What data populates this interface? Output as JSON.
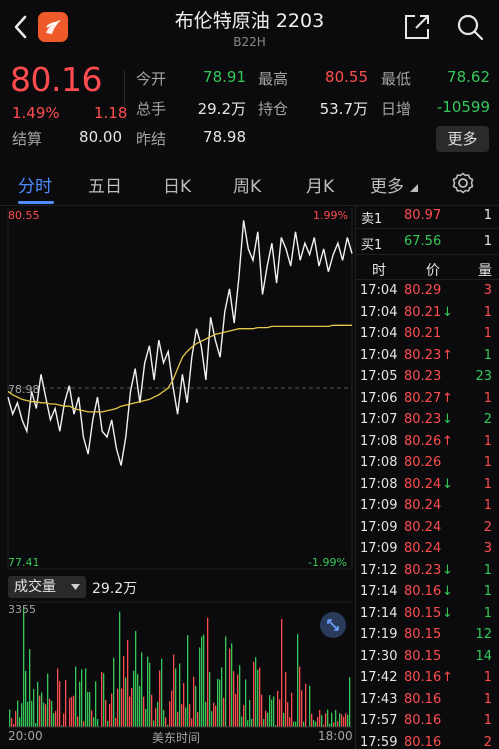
{
  "header": {
    "title": "布伦特原油 2203",
    "subtitle": "B22H"
  },
  "quote": {
    "price": "80.16",
    "change_pct": "1.49%",
    "change": "1.18",
    "settle_label": "结算",
    "settle_value": "80.00",
    "fields": [
      {
        "label": "今开",
        "value": "78.91",
        "color": "#35c759"
      },
      {
        "label": "最高",
        "value": "80.55",
        "color": "#ff4d4f"
      },
      {
        "label": "最低",
        "value": "78.62",
        "color": "#35c759"
      },
      {
        "label": "总手",
        "value": "29.2万",
        "color": "#e6e6e6"
      },
      {
        "label": "持仓",
        "value": "53.7万",
        "color": "#e6e6e6"
      },
      {
        "label": "日增",
        "value": "-10599",
        "color": "#35c759"
      },
      {
        "label": "昨结",
        "value": "78.98",
        "color": "#e6e6e6"
      }
    ],
    "more_label": "更多"
  },
  "tabs": [
    {
      "label": "分时",
      "active": true
    },
    {
      "label": "五日"
    },
    {
      "label": "日K"
    },
    {
      "label": "周K"
    },
    {
      "label": "月K"
    },
    {
      "label": "更多"
    }
  ],
  "chart": {
    "top_left": "80.55",
    "top_right": "1.99%",
    "mid_left": "78.98",
    "bottom_left": "77.41",
    "bottom_right": "-1.99%",
    "x_start": "20:00",
    "x_mid": "美东时间",
    "x_end": "18:00"
  },
  "volume": {
    "label": "成交量",
    "value": "29.2万",
    "max_label": "3355"
  },
  "orderbook": [
    {
      "side": "卖1",
      "price": "80.97",
      "qty": "1",
      "color": "#ff4d4f"
    },
    {
      "side": "买1",
      "price": "67.56",
      "qty": "1",
      "color": "#35c759"
    }
  ],
  "trades_header": {
    "time": "时",
    "price": "价",
    "qty": "量"
  },
  "trades": [
    {
      "time": "17:04",
      "price": "80.29",
      "arrow": "",
      "qty": "3",
      "qcolor": "#ff4d4f"
    },
    {
      "time": "17:04",
      "price": "80.21",
      "arrow": "↓",
      "qty": "1",
      "qcolor": "#ff4d4f"
    },
    {
      "time": "17:04",
      "price": "80.21",
      "arrow": "",
      "qty": "1",
      "qcolor": "#ff4d4f"
    },
    {
      "time": "17:04",
      "price": "80.23",
      "arrow": "↑",
      "qty": "1",
      "qcolor": "#35c759"
    },
    {
      "time": "17:05",
      "price": "80.23",
      "arrow": "",
      "qty": "23",
      "qcolor": "#35c759"
    },
    {
      "time": "17:06",
      "price": "80.27",
      "arrow": "↑",
      "qty": "1",
      "qcolor": "#ff4d4f"
    },
    {
      "time": "17:07",
      "price": "80.23",
      "arrow": "↓",
      "qty": "2",
      "qcolor": "#35c759"
    },
    {
      "time": "17:08",
      "price": "80.26",
      "arrow": "↑",
      "qty": "1",
      "qcolor": "#ff4d4f"
    },
    {
      "time": "17:08",
      "price": "80.26",
      "arrow": "",
      "qty": "1",
      "qcolor": "#ff4d4f"
    },
    {
      "time": "17:08",
      "price": "80.24",
      "arrow": "↓",
      "qty": "1",
      "qcolor": "#ff4d4f"
    },
    {
      "time": "17:09",
      "price": "80.24",
      "arrow": "",
      "qty": "1",
      "qcolor": "#ff4d4f"
    },
    {
      "time": "17:09",
      "price": "80.24",
      "arrow": "",
      "qty": "2",
      "qcolor": "#ff4d4f"
    },
    {
      "time": "17:09",
      "price": "80.24",
      "arrow": "",
      "qty": "3",
      "qcolor": "#ff4d4f"
    },
    {
      "time": "17:12",
      "price": "80.23",
      "arrow": "↓",
      "qty": "1",
      "qcolor": "#35c759"
    },
    {
      "time": "17:14",
      "price": "80.16",
      "arrow": "↓",
      "qty": "1",
      "qcolor": "#35c759"
    },
    {
      "time": "17:14",
      "price": "80.15",
      "arrow": "↓",
      "qty": "1",
      "qcolor": "#35c759"
    },
    {
      "time": "17:19",
      "price": "80.15",
      "arrow": "",
      "qty": "12",
      "qcolor": "#35c759"
    },
    {
      "time": "17:30",
      "price": "80.15",
      "arrow": "",
      "qty": "14",
      "qcolor": "#35c759"
    },
    {
      "time": "17:42",
      "price": "80.16",
      "arrow": "↑",
      "qty": "1",
      "qcolor": "#ff4d4f"
    },
    {
      "time": "17:43",
      "price": "80.16",
      "arrow": "",
      "qty": "1",
      "qcolor": "#ff4d4f"
    },
    {
      "time": "17:57",
      "price": "80.16",
      "arrow": "",
      "qty": "1",
      "qcolor": "#ff4d4f"
    },
    {
      "time": "17:59",
      "price": "80.16",
      "arrow": "",
      "qty": "2",
      "qcolor": "#ff4d4f"
    }
  ],
  "chart_data": {
    "type": "line",
    "ylim": [
      77.41,
      80.55
    ],
    "baseline": 78.98,
    "series": [
      {
        "values": [
          78.9,
          78.75,
          78.85,
          78.7,
          78.6,
          78.95,
          78.8,
          79.1,
          78.9,
          78.7,
          78.8,
          78.6,
          78.85,
          79.0,
          78.75,
          78.9,
          78.55,
          78.4,
          78.7,
          78.9,
          78.6,
          78.55,
          78.7,
          78.45,
          78.3,
          78.55,
          78.95,
          79.15,
          78.85,
          79.2,
          79.35,
          79.05,
          79.4,
          79.2,
          79.3,
          79.0,
          78.75,
          79.1,
          78.85,
          79.25,
          79.5,
          79.35,
          79.05,
          79.6,
          79.4,
          79.25,
          79.65,
          79.85,
          79.55,
          79.95,
          80.45,
          80.2,
          80.1,
          80.35,
          79.8,
          80.05,
          80.25,
          79.9,
          80.3,
          80.2,
          80.05,
          80.35,
          80.1,
          80.25,
          80.15,
          80.3,
          80.05,
          80.2,
          80.0,
          80.15,
          80.25,
          80.1,
          80.3,
          80.16
        ]
      },
      {
        "values": [
          78.95,
          78.92,
          78.9,
          78.88,
          78.87,
          78.86,
          78.86,
          78.85,
          78.85,
          78.84,
          78.84,
          78.83,
          78.82,
          78.82,
          78.8,
          78.79,
          78.78,
          78.77,
          78.77,
          78.77,
          78.77,
          78.78,
          78.79,
          78.8,
          78.82,
          78.83,
          78.84,
          78.85,
          78.86,
          78.87,
          78.88,
          78.9,
          78.92,
          78.95,
          78.98,
          79.05,
          79.15,
          79.25,
          79.3,
          79.34,
          79.37,
          79.39,
          79.41,
          79.43,
          79.45,
          79.46,
          79.47,
          79.48,
          79.49,
          79.5,
          79.5,
          79.5,
          79.5,
          79.51,
          79.51,
          79.51,
          79.52,
          79.52,
          79.52,
          79.52,
          79.52,
          79.52,
          79.52,
          79.52,
          79.52,
          79.52,
          79.52,
          79.52,
          79.52,
          79.53,
          79.53,
          79.53,
          79.53,
          79.53
        ]
      }
    ]
  }
}
